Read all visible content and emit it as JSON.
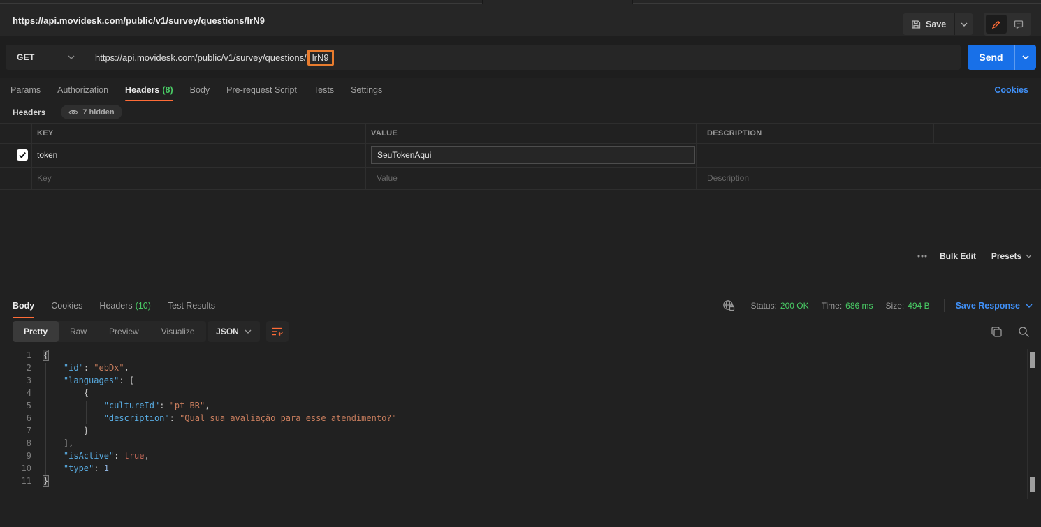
{
  "topbar": {
    "title": "https://api.movidesk.com/public/v1/survey/questions/lrN9",
    "save_label": "Save"
  },
  "request": {
    "method": "GET",
    "url_base": "https://api.movidesk.com/public/v1/survey/questions/",
    "url_id": "lrN9",
    "send_label": "Send",
    "tabs": [
      {
        "label": "Params"
      },
      {
        "label": "Authorization"
      },
      {
        "label": "Headers",
        "count": "(8)"
      },
      {
        "label": "Body"
      },
      {
        "label": "Pre-request Script"
      },
      {
        "label": "Tests"
      },
      {
        "label": "Settings"
      }
    ],
    "cookies_link": "Cookies"
  },
  "headers_editor": {
    "title": "Headers",
    "hidden_pill": "7 hidden",
    "columns": {
      "key": "KEY",
      "value": "VALUE",
      "description": "DESCRIPTION"
    },
    "bulk_edit": "Bulk Edit",
    "presets": "Presets",
    "rows": [
      {
        "checked": true,
        "key": "token",
        "value": "SeuTokenAqui",
        "description": ""
      }
    ],
    "placeholders": {
      "key": "Key",
      "value": "Value",
      "description": "Description"
    }
  },
  "response": {
    "tabs": [
      {
        "label": "Body"
      },
      {
        "label": "Cookies"
      },
      {
        "label": "Headers",
        "count": "(10)"
      },
      {
        "label": "Test Results"
      }
    ],
    "meta": {
      "status_label": "Status:",
      "status_value": "200 OK",
      "time_label": "Time:",
      "time_value": "686 ms",
      "size_label": "Size:",
      "size_value": "494 B",
      "save_response_label": "Save Response"
    },
    "view_tabs": [
      {
        "label": "Pretty"
      },
      {
        "label": "Raw"
      },
      {
        "label": "Preview"
      },
      {
        "label": "Visualize"
      }
    ],
    "format": "JSON",
    "code_lines": [
      [
        [
          "m",
          "{"
        ]
      ],
      [
        [
          "w",
          "    "
        ],
        [
          "k",
          "\"id\""
        ],
        [
          "p",
          ": "
        ],
        [
          "s",
          "\"ebDx\""
        ],
        [
          "p",
          ","
        ]
      ],
      [
        [
          "w",
          "    "
        ],
        [
          "k",
          "\"languages\""
        ],
        [
          "p",
          ": ["
        ]
      ],
      [
        [
          "w",
          "        "
        ],
        [
          "p",
          "{"
        ]
      ],
      [
        [
          "w",
          "            "
        ],
        [
          "k",
          "\"cultureId\""
        ],
        [
          "p",
          ": "
        ],
        [
          "s",
          "\"pt-BR\""
        ],
        [
          "p",
          ","
        ]
      ],
      [
        [
          "w",
          "            "
        ],
        [
          "k",
          "\"description\""
        ],
        [
          "p",
          ": "
        ],
        [
          "s",
          "\"Qual sua avaliação para esse atendimento?\""
        ]
      ],
      [
        [
          "w",
          "        "
        ],
        [
          "p",
          "}"
        ]
      ],
      [
        [
          "w",
          "    "
        ],
        [
          "p",
          "],"
        ]
      ],
      [
        [
          "w",
          "    "
        ],
        [
          "k",
          "\"isActive\""
        ],
        [
          "p",
          ": "
        ],
        [
          "b",
          "true"
        ],
        [
          "p",
          ","
        ]
      ],
      [
        [
          "w",
          "    "
        ],
        [
          "k",
          "\"type\""
        ],
        [
          "p",
          ": "
        ],
        [
          "n",
          "1"
        ]
      ],
      [
        [
          "m",
          "}"
        ]
      ]
    ]
  },
  "colors": {
    "brand_orange": "#ff6c37",
    "annotation_orange": "#e87c2e",
    "success_green": "#49cc65",
    "link_blue": "#4090f7",
    "send_button_blue": "#1870e8",
    "json_key": "#58aadf",
    "json_string": "#c87d5d",
    "json_boolean": "#c96a5a",
    "json_number": "#8fb3de"
  }
}
